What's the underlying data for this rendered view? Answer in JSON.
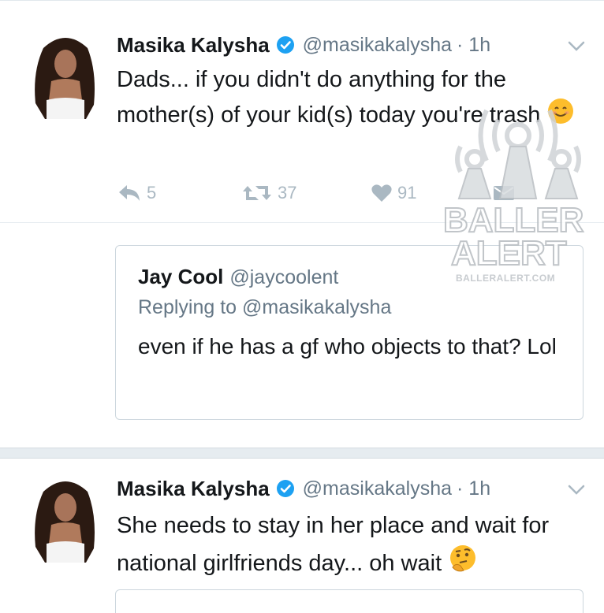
{
  "tweet1": {
    "name": "Masika Kalysha",
    "handle": "@masikakalysha",
    "time": "· 1h",
    "text": "Dads... if you didn't do anything for the mother(s) of your kid(s) today you're trash",
    "emoji_icon": "smiling-face-icon",
    "reply_count": "5",
    "retweet_count": "37",
    "like_count": "91"
  },
  "quote": {
    "name": "Jay Cool",
    "handle": "@jaycoolent",
    "replying_to": "Replying to @masikakalysha",
    "text": "even if he has a gf who objects to that? Lol"
  },
  "tweet2": {
    "name": "Masika Kalysha",
    "handle": "@masikakalysha",
    "time": "· 1h",
    "text": "She needs to stay in her place and wait for national girlfriends day... oh wait",
    "emoji_icon": "thinking-face-icon"
  },
  "watermark": {
    "line1": "BALLER",
    "line2": "ALERT",
    "site": "BALLERALERT.COM"
  },
  "colors": {
    "verified": "#1da1f2",
    "secondary_text": "#657786",
    "action_gray": "#aab8c2",
    "border": "#e1e8ed"
  }
}
